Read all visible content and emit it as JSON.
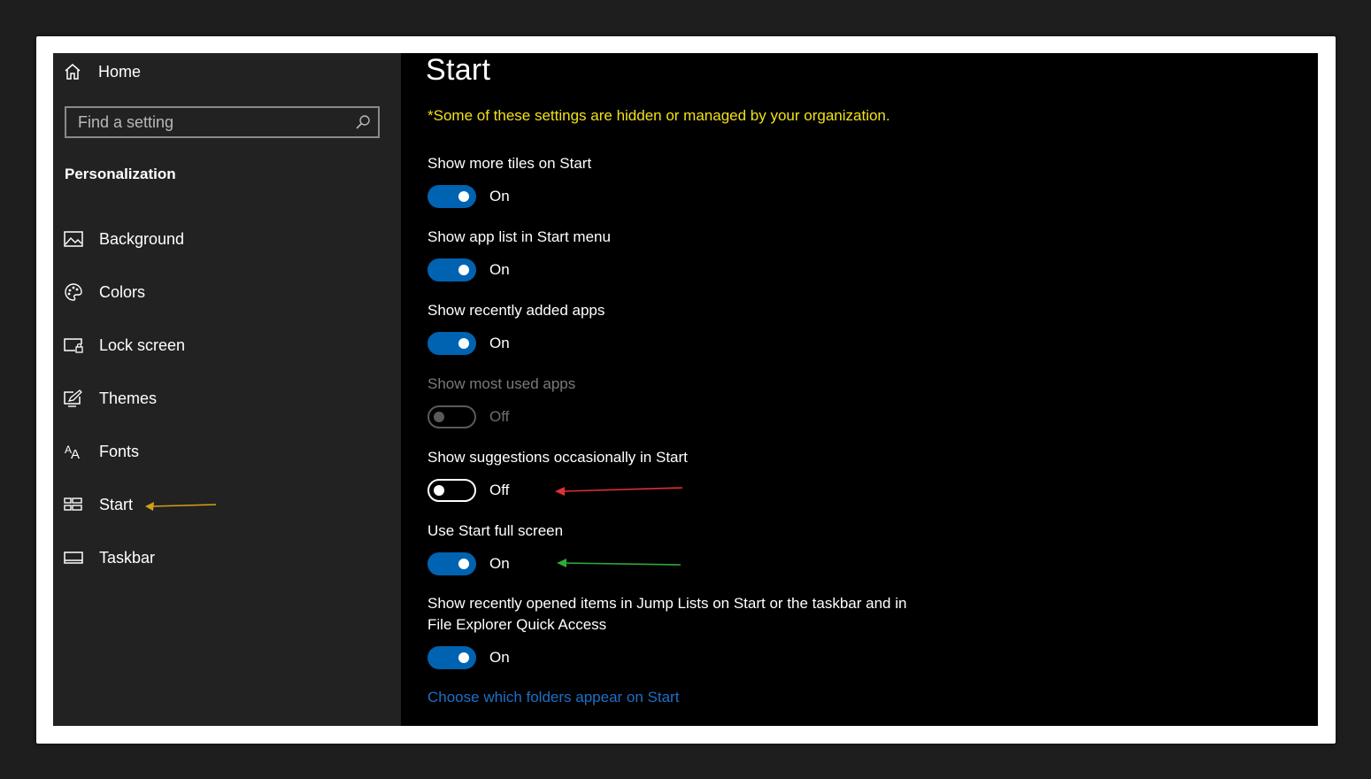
{
  "sidebar": {
    "home_label": "Home",
    "search_placeholder": "Find a setting",
    "section_title": "Personalization",
    "items": [
      {
        "label": "Background",
        "icon": "picture-icon"
      },
      {
        "label": "Colors",
        "icon": "palette-icon"
      },
      {
        "label": "Lock screen",
        "icon": "lock-screen-icon"
      },
      {
        "label": "Themes",
        "icon": "themes-icon"
      },
      {
        "label": "Fonts",
        "icon": "fonts-icon"
      },
      {
        "label": "Start",
        "icon": "start-icon"
      },
      {
        "label": "Taskbar",
        "icon": "taskbar-icon"
      }
    ]
  },
  "main": {
    "title": "Start",
    "org_note": "*Some of these settings are hidden or managed by your organization.",
    "settings": [
      {
        "label": "Show more tiles on Start",
        "state": "On",
        "on": true,
        "disabled": false
      },
      {
        "label": "Show app list in Start menu",
        "state": "On",
        "on": true,
        "disabled": false
      },
      {
        "label": "Show recently added apps",
        "state": "On",
        "on": true,
        "disabled": false
      },
      {
        "label": "Show most used apps",
        "state": "Off",
        "on": false,
        "disabled": true
      },
      {
        "label": "Show suggestions occasionally in Start",
        "state": "Off",
        "on": false,
        "disabled": false
      },
      {
        "label": "Use Start full screen",
        "state": "On",
        "on": true,
        "disabled": false
      },
      {
        "label_line1": "Show recently opened items in Jump Lists on Start or the taskbar and in",
        "label_line2": "File Explorer Quick Access",
        "state": "On",
        "on": true,
        "disabled": false
      }
    ],
    "folders_link": "Choose which folders appear on Start"
  },
  "colors": {
    "accent": "#0063b1",
    "warning_text": "#f2e01a",
    "link": "#1e6fc7",
    "annotation_orange": "#d4a017",
    "annotation_red": "#e03030",
    "annotation_green": "#2eaa3a"
  }
}
